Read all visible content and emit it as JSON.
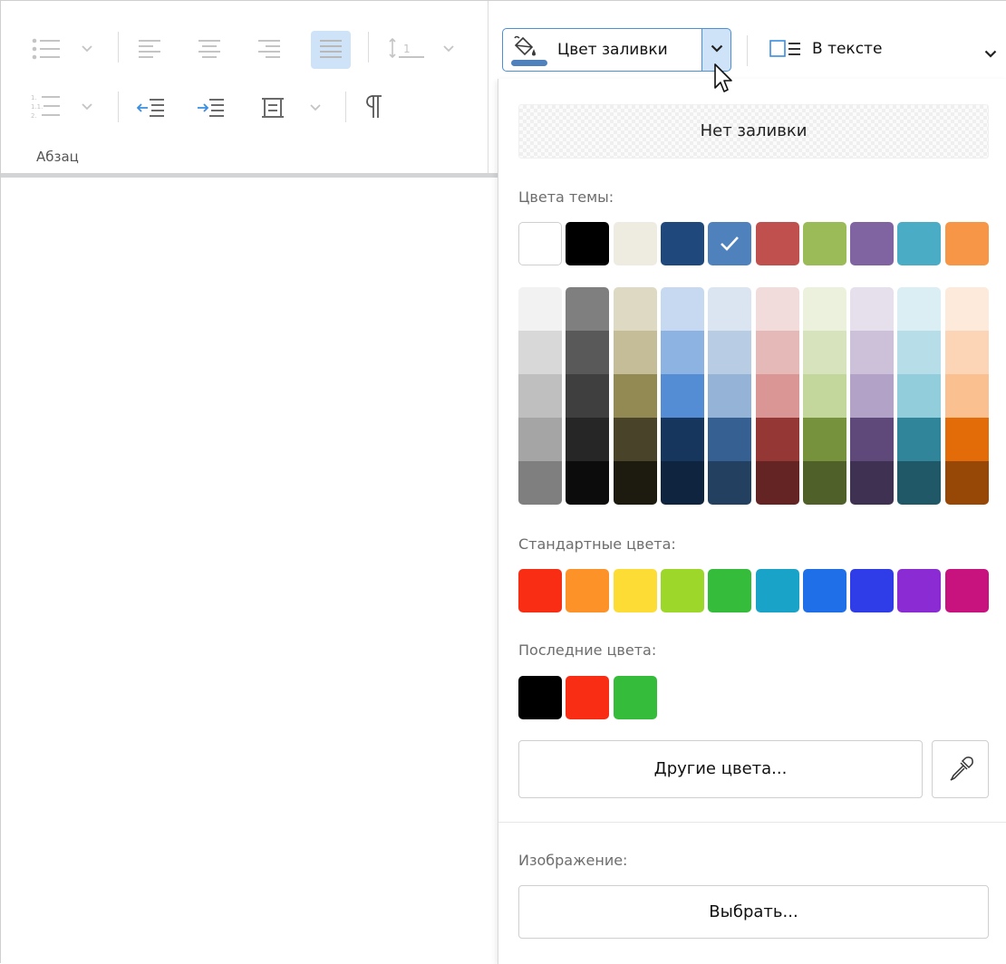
{
  "ribbon": {
    "paragraph_group_label": "Абзац"
  },
  "fill": {
    "button_label": "Цвет заливки",
    "wrap_label": "В тексте"
  },
  "popup": {
    "no_fill_label": "Нет заливки",
    "theme_colors_label": "Цвета темы:",
    "standard_colors_label": "Стандартные цвета:",
    "recent_colors_label": "Последние цвета:",
    "other_colors_label": "Другие цвета...",
    "image_label": "Изображение:",
    "choose_label": "Выбрать...",
    "theme_colors": [
      "#ffffff",
      "#000000",
      "#eeece1",
      "#1f497d",
      "#4f81bd",
      "#c0504d",
      "#9bbb59",
      "#8064a2",
      "#4bacc6",
      "#f79646"
    ],
    "selected_theme_color": "#4f81bd",
    "theme_shades": [
      [
        "#f2f2f2",
        "#d8d8d8",
        "#bfbfbf",
        "#a5a5a5",
        "#7f7f7f"
      ],
      [
        "#7f7f7f",
        "#595959",
        "#3f3f3f",
        "#262626",
        "#0c0c0c"
      ],
      [
        "#ddd9c3",
        "#c4bd97",
        "#938953",
        "#494429",
        "#1d1b10"
      ],
      [
        "#c6d9f0",
        "#8db3e2",
        "#548dd4",
        "#17365d",
        "#0f243e"
      ],
      [
        "#dbe5f1",
        "#b8cce4",
        "#95b3d7",
        "#366092",
        "#244061"
      ],
      [
        "#f2dcdb",
        "#e5b9b7",
        "#d99694",
        "#953734",
        "#632423"
      ],
      [
        "#ebf1dd",
        "#d7e3bc",
        "#c3d69b",
        "#76923c",
        "#4f6128"
      ],
      [
        "#e5e0ec",
        "#ccc1d9",
        "#b2a2c7",
        "#5f497a",
        "#3f3151"
      ],
      [
        "#dbeef3",
        "#b7dde8",
        "#92cddc",
        "#31859b",
        "#205867"
      ],
      [
        "#fdeada",
        "#fbd5b5",
        "#fac08f",
        "#e36c09",
        "#974806"
      ]
    ],
    "standard_colors": [
      "#f92c14",
      "#fd9228",
      "#fddd35",
      "#9cd72a",
      "#34bc3a",
      "#1aa3c8",
      "#1f6fe8",
      "#2f3de8",
      "#8a2bd4",
      "#c8137e"
    ],
    "recent_colors": [
      "#000000",
      "#f92c14",
      "#34bc3a"
    ]
  },
  "icons": {
    "bullets": "bulleted-list-icon",
    "numbering": "numbered-list-icon",
    "align_left": "align-left-icon",
    "align_center": "align-center-icon",
    "align_right": "align-right-icon",
    "justify": "justify-icon",
    "line_spacing": "line-spacing-icon",
    "decrease_indent": "decrease-indent-icon",
    "increase_indent": "increase-indent-icon",
    "borders": "paragraph-borders-icon",
    "pilcrow": "pilcrow-icon",
    "fill": "paint-bucket-icon",
    "wrap": "text-wrap-icon",
    "eyedropper": "eyedropper-icon",
    "cursor": "mouse-pointer-icon"
  }
}
